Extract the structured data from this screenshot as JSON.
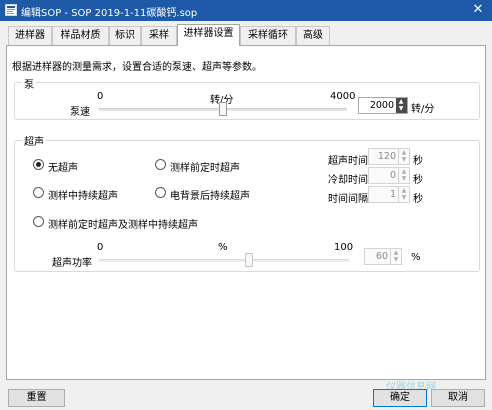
{
  "window": {
    "title": "编辑SOP - SOP 2019-1-11碳酸钙.sop",
    "close_symbol": "✕"
  },
  "tabs": [
    {
      "label": "进样器"
    },
    {
      "label": "样品材质"
    },
    {
      "label": "标识"
    },
    {
      "label": "采样"
    },
    {
      "label": "进样器设置",
      "active": true
    },
    {
      "label": "采样循环"
    },
    {
      "label": "高级"
    }
  ],
  "description": "根据进样器的测量需求，设置合适的泵速、超声等参数。",
  "pump": {
    "group_label": "泵",
    "speed_label": "泵速",
    "slider_min": "0",
    "slider_unit": "转/分",
    "slider_max": "4000",
    "value": "2000",
    "value_numeric": 2000,
    "unit": "转/分"
  },
  "ultrasound": {
    "group_label": "超声",
    "options": [
      {
        "label": "无超声",
        "selected": true
      },
      {
        "label": "测样前定时超声",
        "selected": false
      },
      {
        "label": "测样中持续超声",
        "selected": false
      },
      {
        "label": "电背景后持续超声",
        "selected": false
      },
      {
        "label": "测样前定时超声及测样中持续超声",
        "selected": false
      }
    ],
    "ultrasound_time": {
      "label": "超声时间",
      "value": "120",
      "unit": "秒"
    },
    "cooling_time": {
      "label": "冷却时间",
      "value": "0",
      "unit": "秒"
    },
    "time_interval": {
      "label": "时间间隔",
      "value": "1",
      "unit": "秒"
    },
    "power": {
      "label": "超声功率",
      "slider_min": "0",
      "slider_unit": "%",
      "slider_max": "100",
      "value": "60",
      "value_numeric": 60,
      "unit": "%"
    }
  },
  "footer": {
    "reset_label": "重置",
    "ok_label": "确定",
    "cancel_label": "取消"
  },
  "watermark": "仪器信息网"
}
